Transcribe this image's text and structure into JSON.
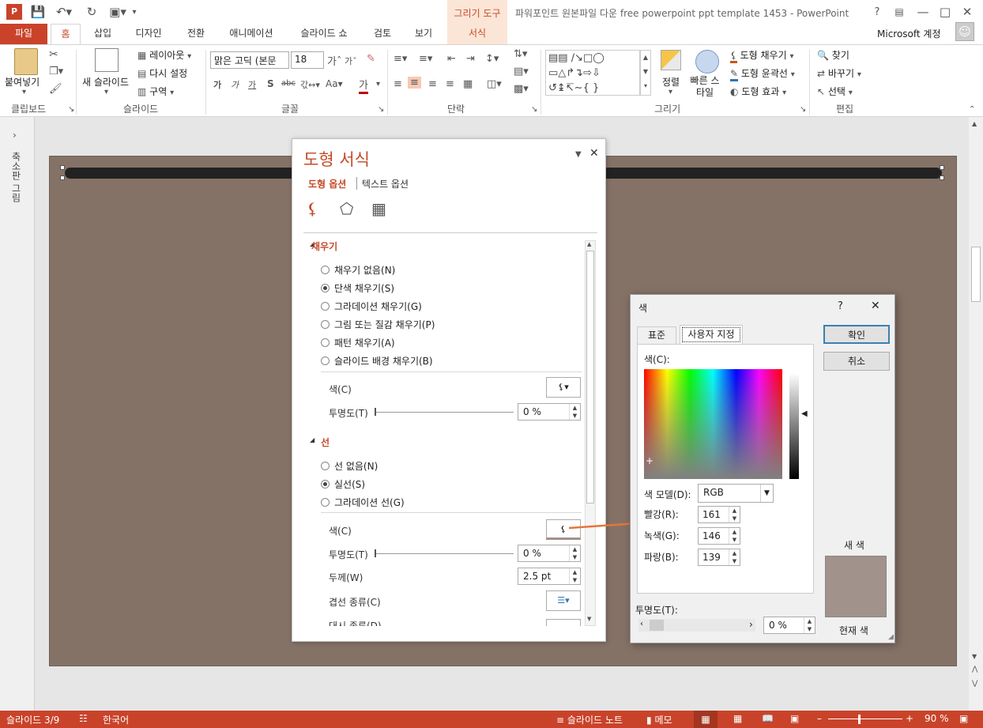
{
  "app": {
    "window_title": "파워포인트 원본파일 다운 free powerpoint ppt template 1453 - PowerPoint",
    "contextual_tab_group": "그리기 도구",
    "account": "Microsoft 계정"
  },
  "tabs": [
    "파일",
    "홈",
    "삽입",
    "디자인",
    "전환",
    "애니메이션",
    "슬라이드 쇼",
    "검토",
    "보기",
    "서식"
  ],
  "ribbon": {
    "clipboard": {
      "paste": "붙여넣기",
      "group": "클립보드"
    },
    "slides": {
      "new_slide": "새 슬라이드",
      "layout": "레이아웃",
      "reset": "다시 설정",
      "section": "구역",
      "group": "슬라이드"
    },
    "font": {
      "font_name": "맑은 고딕 (본문",
      "font_size": "18",
      "group": "글꼴"
    },
    "paragraph": {
      "group": "단락"
    },
    "drawing": {
      "arrange": "정렬",
      "quick_styles": "빠른 스타일",
      "shape_fill": "도형 채우기",
      "shape_outline": "도형 윤곽선",
      "shape_effects": "도형 효과",
      "group": "그리기"
    },
    "editing": {
      "find": "찾기",
      "replace": "바꾸기",
      "select": "선택",
      "group": "편집"
    }
  },
  "left_pane": {
    "label": "축소판 그림"
  },
  "format_pane": {
    "title": "도형 서식",
    "tab_shape": "도형 옵션",
    "tab_text": "텍스트 옵션",
    "fill_section": "채우기",
    "fill_options": [
      "채우기 없음(N)",
      "단색 채우기(S)",
      "그라데이션 채우기(G)",
      "그림 또는 질감 채우기(P)",
      "패턴 채우기(A)",
      "슬라이드 배경 채우기(B)"
    ],
    "fill_selected": 1,
    "fill_color_label": "색(C)",
    "fill_transparency_label": "투명도(T)",
    "fill_transparency": "0 %",
    "line_section": "선",
    "line_options": [
      "선 없음(N)",
      "실선(S)",
      "그라데이션 선(G)"
    ],
    "line_selected": 1,
    "line_color_label": "색(C)",
    "line_transparency_label": "투명도(T)",
    "line_transparency": "0 %",
    "width_label": "두께(W)",
    "width_value": "2.5 pt",
    "compound_label": "겹선 종류(C)",
    "dash_label": "대시 종류(D)"
  },
  "color_dialog": {
    "title": "색",
    "help": "?",
    "tab_standard": "표준",
    "tab_custom": "사용자 지정",
    "colors_label": "색(C):",
    "model_label": "색 모델(D):",
    "model_value": "RGB",
    "red_label": "빨강(R):",
    "red": "161",
    "green_label": "녹색(G):",
    "green": "146",
    "blue_label": "파랑(B):",
    "blue": "139",
    "transparency_label": "투명도(T):",
    "transparency": "0 %",
    "ok": "확인",
    "cancel": "취소",
    "new_label": "새 색",
    "current_label": "현재 색",
    "new_color": "#a1928b"
  },
  "status": {
    "slide": "슬라이드 3/9",
    "language": "한국어",
    "notes": "슬라이드 노트",
    "comments": "메모",
    "zoom": "90 %"
  },
  "colors": {
    "accent": "#c9432a",
    "slide_bg": "#857267"
  }
}
